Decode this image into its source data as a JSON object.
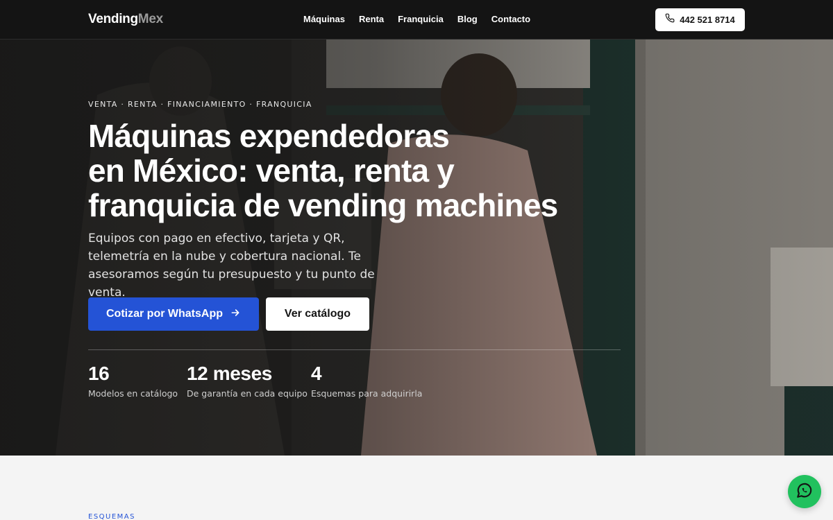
{
  "header": {
    "logo_primary": "Vending",
    "logo_secondary": "Mex",
    "nav": [
      {
        "label": "Máquinas"
      },
      {
        "label": "Renta"
      },
      {
        "label": "Franquicia"
      },
      {
        "label": "Blog"
      },
      {
        "label": "Contacto"
      }
    ],
    "phone": "442 521 8714",
    "phone_icon": "phone-icon"
  },
  "hero": {
    "eyebrow": "VENTA · RENTA · FINANCIAMIENTO · FRANQUICIA",
    "title_line1": "Máquinas expendedoras",
    "title_line2": "en México: venta, renta y",
    "title_line3": "franquicia de vending machines",
    "description": "Equipos con pago en efectivo, tarjeta y QR, telemetría en la nube y cobertura nacional. Te asesoramos según tu presupuesto y tu punto de venta.",
    "primary_cta": "Cotizar por WhatsApp",
    "primary_cta_icon": "arrow-right-icon",
    "secondary_cta": "Ver catálogo",
    "stats": [
      {
        "value": "16",
        "label": "Modelos en catálogo"
      },
      {
        "value": "12 meses",
        "label": "De garantía en cada equipo"
      },
      {
        "value": "4",
        "label": "Esquemas para adquirirla"
      }
    ]
  },
  "section": {
    "label": "ESQUEMAS"
  },
  "whatsapp_float_icon": "whatsapp-icon",
  "colors": {
    "accent": "#2453d6",
    "whatsapp": "#21c15e",
    "header_bg": "#141414"
  }
}
